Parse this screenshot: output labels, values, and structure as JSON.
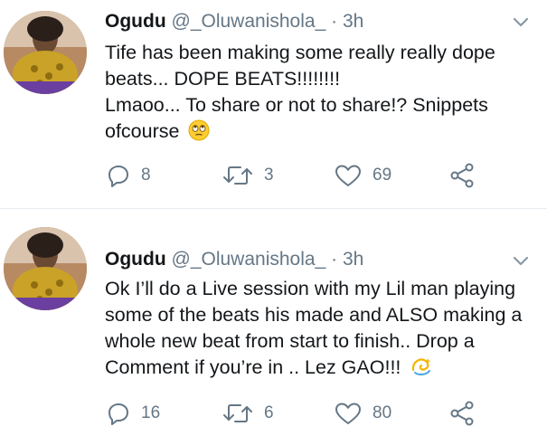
{
  "tweets": [
    {
      "name": "Ogudu",
      "handle": "@_Oluwanishola_",
      "separator": "·",
      "time": "3h",
      "lines": [
        "Tife has been making some really really dope",
        "beats... DOPE BEATS!!!!!!!!",
        "Lmaoo... To share or not to share!? Snippets",
        "ofcourse"
      ],
      "emoji_icon": "eye-roll-emoji-icon",
      "replies": "8",
      "retweets": "3",
      "likes": "69"
    },
    {
      "name": "Ogudu",
      "handle": "@_Oluwanishola_",
      "separator": "·",
      "time": "3h",
      "lines": [
        "Ok I’ll do a Live session with my Lil man playing",
        "some of the beats his made and ALSO making a",
        "whole new beat from start to finish.. Drop a",
        "Comment if you’re in .. Lez GAO!!!"
      ],
      "emoji_icon": "dizzy-emoji-icon",
      "replies": "16",
      "retweets": "6",
      "likes": "80"
    }
  ],
  "colors": {
    "text": "#14171a",
    "secondary": "#657786",
    "divider": "#e6ecf0"
  },
  "icons": [
    "reply-icon",
    "retweet-icon",
    "like-icon",
    "share-icon",
    "chevron-down-icon"
  ]
}
